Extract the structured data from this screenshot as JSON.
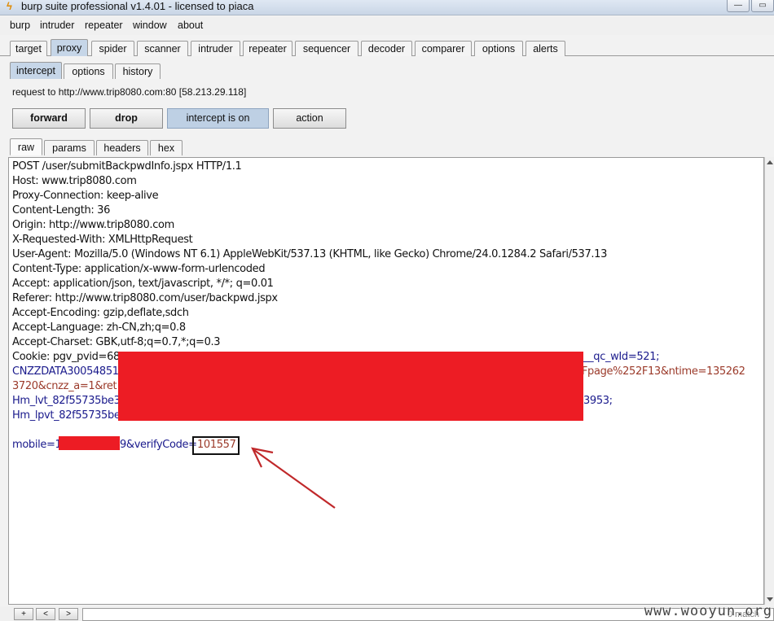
{
  "window": {
    "title": "burp suite professional v1.4.01 - licensed to piaca",
    "minimize_glyph": "—",
    "maximize_glyph": "▭"
  },
  "menu": [
    "burp",
    "intruder",
    "repeater",
    "window",
    "about"
  ],
  "main_tabs": [
    "target",
    "proxy",
    "spider",
    "scanner",
    "intruder",
    "repeater",
    "sequencer",
    "decoder",
    "comparer",
    "options",
    "alerts"
  ],
  "proxy_tabs": [
    "intercept",
    "options",
    "history"
  ],
  "request_info": "request to http://www.trip8080.com:80  [58.213.29.118]",
  "buttons": {
    "forward": "forward",
    "drop": "drop",
    "intercept": "intercept is on",
    "action": "action"
  },
  "view_tabs": [
    "raw",
    "params",
    "headers",
    "hex"
  ],
  "request_lines": [
    "POST /user/submitBackpwdInfo.jspx HTTP/1.1",
    "Host: www.trip8080.com",
    "Proxy-Connection: keep-alive",
    "Content-Length: 36",
    "Origin: http://www.trip8080.com",
    "X-Requested-With: XMLHttpRequest",
    "User-Agent: Mozilla/5.0 (Windows NT 6.1) AppleWebKit/537.13 (KHTML, like Gecko) Chrome/24.0.1284.2 Safari/537.13",
    "Content-Type: application/x-www-form-urlencoded",
    "Accept: application/json, text/javascript, */*; q=0.01",
    "Referer: http://www.trip8080.com/user/backpwd.jspx",
    "Accept-Encoding: gzip,deflate,sdch",
    "Accept-Language: zh-CN,zh;q=0.8",
    "Accept-Charset: GBK,utf-8;q=0.7,*;q=0.3"
  ],
  "cookie_fragments": {
    "line1_left": "Cookie: pgv_pvid=68",
    "line1_right": "__qc_wId=521;",
    "line2_left": "CNZZDATA30054851",
    "line2_right": "2Fpage%252F13&ntime=135262",
    "line3_left": "3720&cnzz_a=1&ret",
    "line4_left": "Hm_lvt_82f55735be3",
    "line4_right": "3953;",
    "line5_left": "Hm_lpvt_82f55735be"
  },
  "body_line": {
    "prefix": "mobile=1",
    "suffix": "9&verifyCode=",
    "verify_code": "101557"
  },
  "bottom": {
    "plus": "+",
    "prev": "<",
    "next": ">",
    "matches": "0 match"
  },
  "watermark": "www.wooyun.org",
  "colors": {
    "redaction": "#ed1c24",
    "annotation_arrow": "#c0282a",
    "active_tab": "#c6d6e8"
  }
}
